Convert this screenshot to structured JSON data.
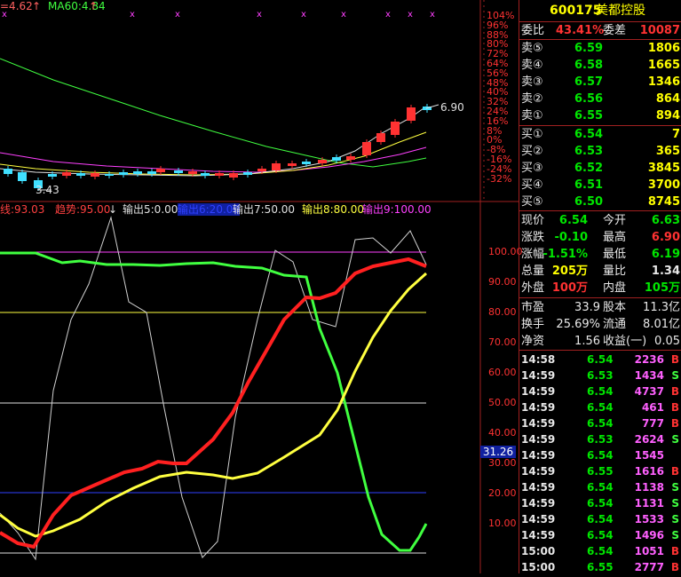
{
  "chart": {
    "top_legend": {
      "ma_prefix": "=4.62",
      "ma60": "MA60:4.84"
    },
    "price_axis": [
      "104%",
      "96%",
      "88%",
      "80%",
      "72%",
      "64%",
      "56%",
      "48%",
      "40%",
      "32%",
      "24%",
      "16%",
      "8%",
      "0%",
      "-8%",
      "-16%",
      "-24%",
      "-32%"
    ],
    "high_label": "6.90",
    "low_label": "3.43",
    "indicator_legend": [
      {
        "text": "线:93.03",
        "color": "#ff4040"
      },
      {
        "text": "趋势:95.00",
        "color": "#ff4040"
      },
      {
        "text": "输出5:0.00",
        "color": "#e0e0e0"
      },
      {
        "text": "输出6:20.00",
        "color": "#3040ff"
      },
      {
        "text": "输出7:50.00",
        "color": "#e0e0e0"
      },
      {
        "text": "输出8:80.00",
        "color": "#ffff40"
      },
      {
        "text": "输出9:100.00",
        "color": "#ff40ff"
      }
    ],
    "ind_axis": [
      "100.00",
      "90.00",
      "80.00",
      "70.00",
      "60.00",
      "50.00",
      "40.00",
      "30.00",
      "20.00",
      "10.00"
    ],
    "cursor_value": "31.26",
    "colors": {
      "up": "#ff3232",
      "down": "#40e0ff",
      "grid": "#a02020",
      "white": "#e0e0e0",
      "yellow": "#ffff40",
      "green": "#40ff40",
      "magenta": "#ff40ff",
      "blue": "#3040ff"
    }
  },
  "quote": {
    "code": "600175",
    "name": "美都控股",
    "weibi_label": "委比",
    "weibi_value": "43.41%",
    "weicha_label": "委差",
    "weicha_value": "10087",
    "sell": [
      {
        "label": "卖⑤",
        "price": "6.59",
        "vol": "1806"
      },
      {
        "label": "卖④",
        "price": "6.58",
        "vol": "1665"
      },
      {
        "label": "卖③",
        "price": "6.57",
        "vol": "1346"
      },
      {
        "label": "卖②",
        "price": "6.56",
        "vol": "864"
      },
      {
        "label": "卖①",
        "price": "6.55",
        "vol": "894"
      }
    ],
    "buy": [
      {
        "label": "买①",
        "price": "6.54",
        "vol": "7"
      },
      {
        "label": "买②",
        "price": "6.53",
        "vol": "365"
      },
      {
        "label": "买③",
        "price": "6.52",
        "vol": "3845"
      },
      {
        "label": "买④",
        "price": "6.51",
        "vol": "3700"
      },
      {
        "label": "买⑤",
        "price": "6.50",
        "vol": "8745"
      }
    ],
    "stats": [
      {
        "l1": "现价",
        "v1": "6.54",
        "l2": "今开",
        "v2": "6.63",
        "c1": "grn",
        "c2": "grn"
      },
      {
        "l1": "涨跌",
        "v1": "-0.10",
        "l2": "最高",
        "v2": "6.90",
        "c1": "grn",
        "c2": "red"
      },
      {
        "l1": "涨幅",
        "v1": "-1.51%",
        "l2": "最低",
        "v2": "6.19",
        "c1": "grn",
        "c2": "grn"
      },
      {
        "l1": "总量",
        "v1": "205万",
        "l2": "量比",
        "v2": "1.34",
        "c1": "yel",
        "c2": "wht"
      },
      {
        "l1": "外盘",
        "v1": "100万",
        "l2": "内盘",
        "v2": "105万",
        "c1": "red",
        "c2": "grn"
      }
    ],
    "stats2": [
      {
        "l1": "市盈",
        "v1": "33.9",
        "l2": "股本",
        "v2": "11.3亿"
      },
      {
        "l1": "换手",
        "v1": "25.69%",
        "l2": "流通",
        "v2": "8.01亿"
      },
      {
        "l1": "净资",
        "v1": "1.56",
        "l2": "收益(一)",
        "v2": "0.05"
      }
    ],
    "ticks": [
      {
        "time": "14:58",
        "price": "6.54",
        "vol": "2236",
        "side": "B",
        "pc": "grn"
      },
      {
        "time": "14:59",
        "price": "6.53",
        "vol": "1434",
        "side": "S",
        "pc": "grn"
      },
      {
        "time": "14:59",
        "price": "6.54",
        "vol": "4737",
        "side": "B",
        "pc": "grn"
      },
      {
        "time": "14:59",
        "price": "6.54",
        "vol": "461",
        "side": "B",
        "pc": "grn"
      },
      {
        "time": "14:59",
        "price": "6.54",
        "vol": "777",
        "side": "B",
        "pc": "grn"
      },
      {
        "time": "14:59",
        "price": "6.53",
        "vol": "2624",
        "side": "S",
        "pc": "grn"
      },
      {
        "time": "14:59",
        "price": "6.54",
        "vol": "1545",
        "side": "",
        "pc": "grn"
      },
      {
        "time": "14:59",
        "price": "6.55",
        "vol": "1616",
        "side": "B",
        "pc": "grn"
      },
      {
        "time": "14:59",
        "price": "6.54",
        "vol": "1138",
        "side": "S",
        "pc": "grn"
      },
      {
        "time": "14:59",
        "price": "6.54",
        "vol": "1131",
        "side": "S",
        "pc": "grn"
      },
      {
        "time": "14:59",
        "price": "6.54",
        "vol": "1533",
        "side": "S",
        "pc": "grn"
      },
      {
        "time": "14:59",
        "price": "6.54",
        "vol": "1496",
        "side": "S",
        "pc": "grn"
      },
      {
        "time": "15:00",
        "price": "6.54",
        "vol": "1051",
        "side": "B",
        "pc": "grn"
      },
      {
        "time": "15:00",
        "price": "6.55",
        "vol": "2777",
        "side": "B",
        "pc": "grn"
      }
    ]
  }
}
